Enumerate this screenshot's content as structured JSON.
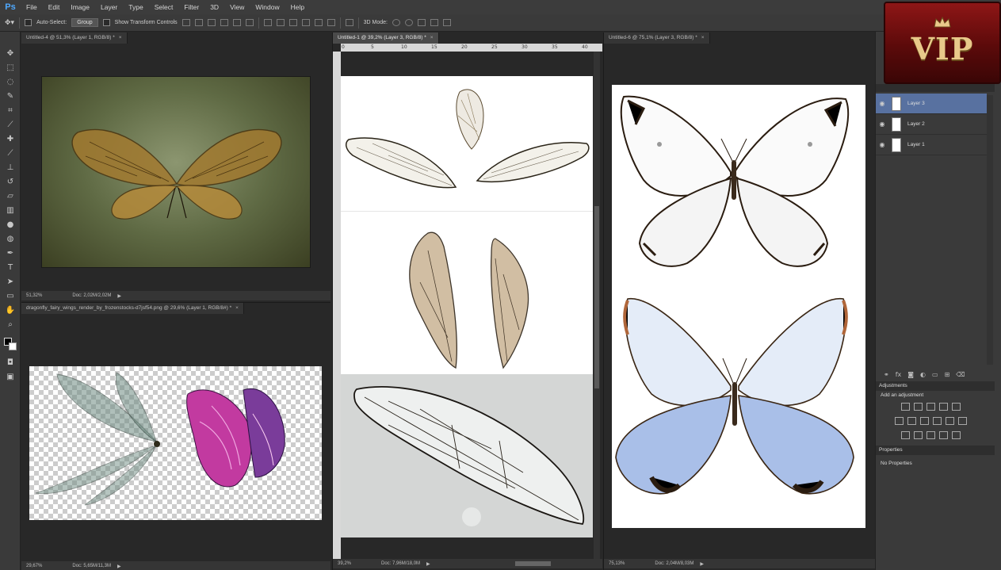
{
  "app": {
    "logo": "Ps"
  },
  "menu": [
    "File",
    "Edit",
    "Image",
    "Layer",
    "Type",
    "Select",
    "Filter",
    "3D",
    "View",
    "Window",
    "Help"
  ],
  "options": {
    "auto_select": "Auto-Select:",
    "auto_select_value": "Group",
    "show_transform": "Show Transform Controls",
    "mode_3d": "3D Mode:"
  },
  "docs": [
    {
      "title": "Untitled-4 @ 51,3% (Layer 1, RGB/8) *",
      "zoom": "51,32%",
      "doc": "Doc: 2,02M/2,02M"
    },
    {
      "title": "dragonfly_fairy_wings_render_by_frozenstocks-d7jsf54.png @ 29,6% (Layer 1, RGB/8#) *",
      "zoom": "29,67%",
      "doc": "Doc: 5,65M/11,3M"
    },
    {
      "title": "Untitled-1 @ 39,2% (Layer 3, RGB/8) *",
      "zoom": "39,2%",
      "doc": "Doc: 7,96M/18,0M"
    },
    {
      "title": "Untitled-6 @ 75,1% (Layer 3, RGB/8) *",
      "zoom": "75,13%",
      "doc": "Doc: 2,04M/8,03M"
    }
  ],
  "ruler_ticks": [
    "0",
    "5",
    "10",
    "15",
    "20",
    "25",
    "30",
    "35",
    "40"
  ],
  "layers": [
    {
      "name": "Layer 3"
    },
    {
      "name": "Layer 2"
    },
    {
      "name": "Layer 1"
    }
  ],
  "panels": {
    "adjustments_title": "Adjustments",
    "adjustments_hint": "Add an adjustment",
    "properties_title": "Properties",
    "properties_text": "No Properties"
  },
  "badge": {
    "text": "VIP"
  },
  "colors": {
    "accent": "#5871a0",
    "badge": "#8e1616"
  }
}
